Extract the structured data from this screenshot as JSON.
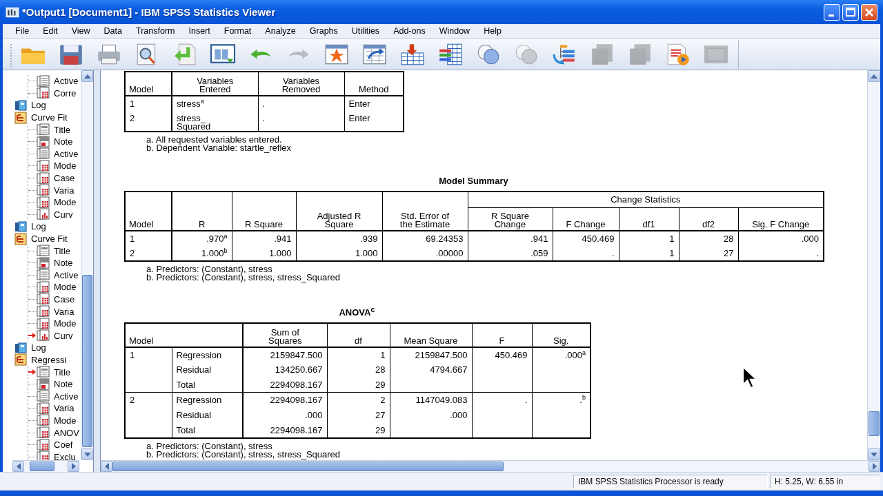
{
  "window": {
    "title": "*Output1 [Document1] - IBM SPSS Statistics Viewer"
  },
  "menu": [
    "File",
    "Edit",
    "View",
    "Data",
    "Transform",
    "Insert",
    "Format",
    "Analyze",
    "Graphs",
    "Utilities",
    "Add-ons",
    "Window",
    "Help"
  ],
  "toolbar": [
    {
      "kind": "folder",
      "disabled": false
    },
    {
      "kind": "disk",
      "disabled": false
    },
    {
      "kind": "printer",
      "disabled": false
    },
    {
      "kind": "preview",
      "disabled": false
    },
    {
      "kind": "export",
      "disabled": false
    },
    {
      "kind": "dialog",
      "disabled": false
    },
    {
      "kind": "undo",
      "disabled": false
    },
    {
      "kind": "redo",
      "disabled": true
    },
    {
      "kind": "star-table",
      "disabled": false
    },
    {
      "kind": "table-arrow",
      "disabled": false
    },
    {
      "kind": "table-down",
      "disabled": false
    },
    {
      "kind": "table-bars",
      "disabled": false
    },
    {
      "kind": "circles",
      "disabled": false
    },
    {
      "kind": "circles",
      "disabled": true
    },
    {
      "kind": "outline",
      "disabled": false
    },
    {
      "kind": "doc-stack",
      "disabled": true
    },
    {
      "kind": "doc-stack",
      "disabled": true
    },
    {
      "kind": "doc-play",
      "disabled": false
    },
    {
      "kind": "panel",
      "disabled": true
    }
  ],
  "outline": [
    {
      "children": [
        {
          "label": "Active",
          "kind": "text",
          "current": false
        },
        {
          "label": "Corre",
          "kind": "table",
          "current": false
        }
      ]
    },
    {
      "label": "Log",
      "kind": "log"
    },
    {
      "label": "Curve Fit",
      "kind": "procedure",
      "children": [
        {
          "label": "Title",
          "kind": "title",
          "current": false
        },
        {
          "label": "Note",
          "kind": "notes",
          "current": false
        },
        {
          "label": "Active",
          "kind": "text",
          "current": false
        },
        {
          "label": "Mode",
          "kind": "table",
          "current": false
        },
        {
          "label": "Case",
          "kind": "table",
          "current": false
        },
        {
          "label": "Varia",
          "kind": "table",
          "current": false
        },
        {
          "label": "Mode",
          "kind": "table",
          "current": false
        },
        {
          "label": "Curv",
          "kind": "chart",
          "current": false
        }
      ]
    },
    {
      "label": "Log",
      "kind": "log"
    },
    {
      "label": "Curve Fit",
      "kind": "procedure",
      "children": [
        {
          "label": "Title",
          "kind": "title",
          "current": false
        },
        {
          "label": "Note",
          "kind": "notes",
          "current": false
        },
        {
          "label": "Active",
          "kind": "text",
          "current": false
        },
        {
          "label": "Mode",
          "kind": "table",
          "current": false
        },
        {
          "label": "Case",
          "kind": "table",
          "current": false
        },
        {
          "label": "Varia",
          "kind": "table",
          "current": false
        },
        {
          "label": "Mode",
          "kind": "table",
          "current": false
        },
        {
          "label": "Curv",
          "kind": "chart",
          "current": true
        }
      ]
    },
    {
      "label": "Log",
      "kind": "log"
    },
    {
      "label": "Regressi",
      "kind": "procedure",
      "children": [
        {
          "label": "Title",
          "kind": "title",
          "current": true
        },
        {
          "label": "Note",
          "kind": "notes",
          "current": false
        },
        {
          "label": "Active",
          "kind": "text",
          "current": false
        },
        {
          "label": "Varia",
          "kind": "table",
          "current": false
        },
        {
          "label": "Mode",
          "kind": "table",
          "current": false
        },
        {
          "label": "ANOV",
          "kind": "table",
          "current": false
        },
        {
          "label": "Coef",
          "kind": "table",
          "current": false
        },
        {
          "label": "Exclu",
          "kind": "table",
          "current": false
        }
      ]
    }
  ],
  "variables_table": {
    "columns": [
      "Model",
      "Variables\nEntered",
      "Variables\nRemoved",
      "Method"
    ],
    "rows": [
      [
        "1",
        "stress$^{a}$",
        ".",
        "Enter"
      ],
      [
        "2",
        "stress_\nSquared",
        ".",
        "Enter"
      ]
    ],
    "footnotes": [
      "a. All requested variables entered.",
      "b. Dependent Variable: startle_reflex"
    ]
  },
  "model_summary": {
    "title": "Model Summary",
    "group_header": "Change Statistics",
    "columns": [
      "Model",
      "R",
      "R Square",
      "Adjusted R\nSquare",
      "Std. Error of\nthe Estimate",
      "R Square\nChange",
      "F Change",
      "df1",
      "df2",
      "Sig. F Change"
    ],
    "rows": [
      [
        "1",
        ".970$^{a}$",
        ".941",
        ".939",
        "69.24353",
        ".941",
        "450.469",
        "1",
        "28",
        ".000"
      ],
      [
        "2",
        "1.000$^{b}$",
        "1.000",
        "1.000",
        ".00000",
        ".059",
        ".",
        "1",
        "27",
        "."
      ]
    ],
    "footnotes": [
      "a. Predictors: (Constant), stress",
      "b. Predictors: (Constant), stress, stress_Squared"
    ]
  },
  "anova": {
    "title": "ANOVA$^{c}$",
    "columns": [
      "Model",
      "Sum of\nSquares",
      "df",
      "Mean Square",
      "F",
      "Sig."
    ],
    "models": [
      {
        "model": "1",
        "rows": [
          [
            "Regression",
            "2159847.500",
            "1",
            "2159847.500",
            "450.469",
            ".000$^{a}$"
          ],
          [
            "Residual",
            "134250.667",
            "28",
            "4794.667"
          ],
          [
            "Total",
            "2294098.167",
            "29"
          ]
        ]
      },
      {
        "model": "2",
        "rows": [
          [
            "Regression",
            "2294098.167",
            "2",
            "1147049.083",
            ".",
            ".$^{b}$"
          ],
          [
            "Residual",
            ".000",
            "27",
            ".000"
          ],
          [
            "Total",
            "2294098.167",
            "29"
          ]
        ]
      }
    ],
    "footnotes": [
      "a. Predictors: (Constant), stress",
      "b. Predictors: (Constant), stress, stress_Squared"
    ]
  },
  "status_bar": {
    "message": "IBM SPSS Statistics Processor is ready",
    "size": "H: 5.25, W: 6.55 in"
  }
}
